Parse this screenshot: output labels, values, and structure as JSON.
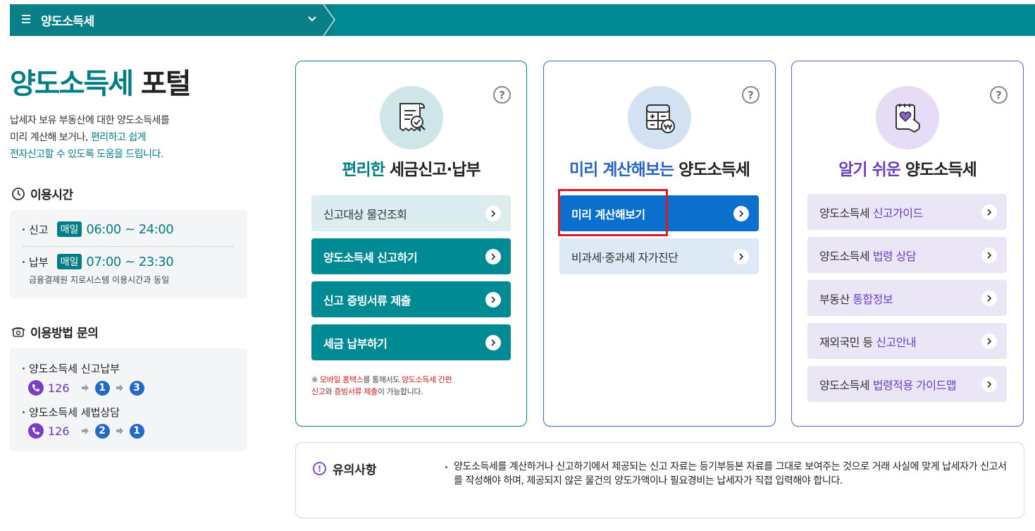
{
  "topbar": {
    "title": "양도소득세"
  },
  "portal": {
    "title_accent": "양도소득세",
    "title_rest": " 포털",
    "intro_line1": "납세자 보유 부동산에 대한 양도소득세를",
    "intro_line2a": "미리 계산해 보거나, ",
    "intro_line2b": "편리하고 쉽게",
    "intro_line3": "전자신고할 수 있도록 도움을 드립니다."
  },
  "hours": {
    "heading": "이용시간",
    "report_label": "신고",
    "report_badge": "매일",
    "report_time": "06:00 ~ 24:00",
    "pay_label": "납부",
    "pay_badge": "매일",
    "pay_time": "07:00 ~ 23:30",
    "pay_note": "금융결제원 지로시스템 이용시간과 동일"
  },
  "inquiry": {
    "heading": "이용방법 문의",
    "items": [
      {
        "label": "양도소득세 신고납부",
        "phone": "126",
        "d1": "1",
        "d2": "3"
      },
      {
        "label": "양도소득세 세법상담",
        "phone": "126",
        "d1": "2",
        "d2": "1"
      }
    ]
  },
  "cards": [
    {
      "title_accent": "편리한",
      "title_rest": " 세금신고·납부",
      "accent_color": "#007d86",
      "buttons": [
        {
          "label": "신고대상 물건조회"
        },
        {
          "label": "양도소득세 신고하기"
        },
        {
          "label": "신고 증빙서류 제출"
        },
        {
          "label": "세금 납부하기"
        }
      ],
      "note": {
        "p1": "※ ",
        "p2": "모바일 홈택스",
        "p3": "를 통해서도 ",
        "p4": "양도소득세 간편",
        "p5": "신고",
        "p6": "와 ",
        "p7": "증빙서류 제출",
        "p8": "이 가능합니다."
      }
    },
    {
      "title_accent": "미리 계산해보는",
      "title_rest": " 양도소득세",
      "accent_color": "#2a63c4",
      "buttons": [
        {
          "label": "미리 계산해보기"
        },
        {
          "label": "비과세·중과세 자가진단"
        }
      ]
    },
    {
      "title_accent": "알기 쉬운",
      "title_rest": " 양도소득세",
      "accent_color": "#6a3fbf",
      "buttons": [
        {
          "a": "양도소득세 ",
          "b": "신고가이드"
        },
        {
          "a": "양도소득세 ",
          "b": "법령 상담"
        },
        {
          "a": "부동산 ",
          "b": "통합정보"
        },
        {
          "a": "재외국민 등 ",
          "b": "신고안내"
        },
        {
          "a": "양도소득세 ",
          "b": "법령적용 가이드맵"
        }
      ]
    }
  ],
  "help_symbol": "?",
  "notice": {
    "heading": "유의사항",
    "text": "양도소득세를 계산하거나 신고하기에서 제공되는 신고 자료는 등기부등본 자료를 그대로 보여주는 것으로 거래 사실에 맞게 납세자가 신고서를 작성해야 하며, 제공되지 않은 물건의 양도가액이나 필요경비는 납세자가 직접 입력해야 합니다."
  }
}
